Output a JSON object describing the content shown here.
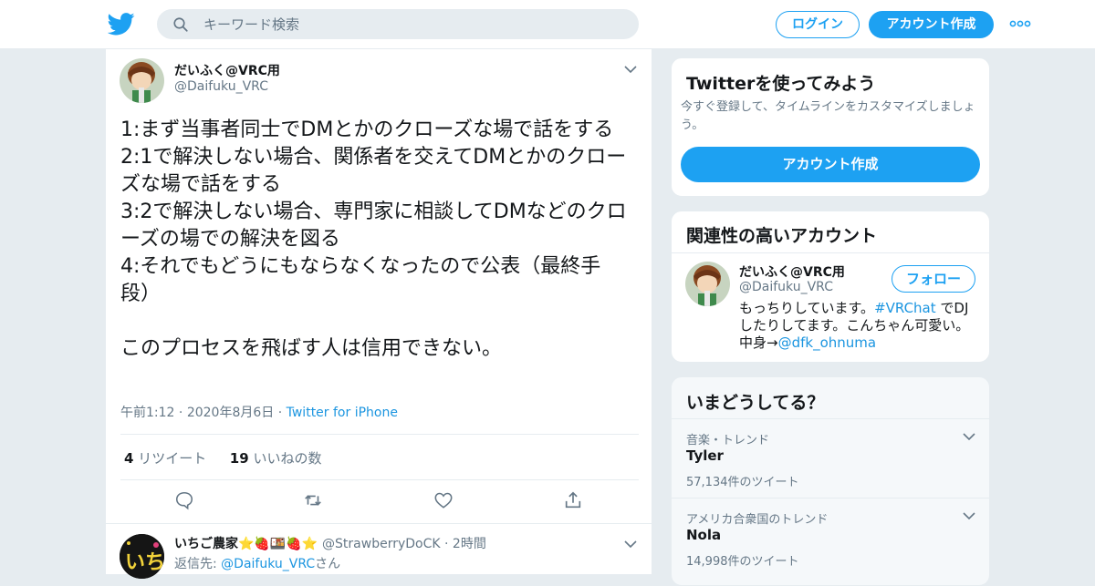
{
  "header": {
    "search_placeholder": "キーワード検索",
    "login_label": "ログイン",
    "signup_label": "アカウント作成",
    "brand_color": "#1da1f2"
  },
  "tweet": {
    "author_name": "だいふく@VRC用",
    "author_handle": "@Daifuku_VRC",
    "text": "1:まず当事者同士でDMとかのクローズな場で話をする\n2:1で解決しない場合、関係者を交えてDMとかのクローズな場で話をする\n3:2で解決しない場合、専門家に相談してDMなどのクローズの場での解決を図る\n4:それでもどうにもならなくなったので公表（最終手段）\n\nこのプロセスを飛ばす人は信用できない。",
    "time": "午前1:12",
    "date": "2020年8月6日",
    "source": "Twitter for iPhone",
    "retweets_count": "4",
    "retweets_label": "リツイート",
    "likes_count": "19",
    "likes_label": "いいねの数",
    "actions": [
      "reply-icon",
      "retweet-icon",
      "like-icon",
      "share-icon"
    ]
  },
  "reply": {
    "author_name": "いちご農家",
    "emoji": "⭐🍓🍱🍓⭐",
    "author_handle": "@StrawberryDoCK",
    "time": "2時間",
    "reply_to_prefix": "返信先: ",
    "reply_to_handle": "@Daifuku_VRC",
    "reply_to_suffix": "さん"
  },
  "signup_card": {
    "title": "Twitterを使ってみよう",
    "subtitle": "今すぐ登録して、タイムラインをカスタマイズしましょう。",
    "button_label": "アカウント作成"
  },
  "related_card": {
    "title": "関連性の高いアカウント",
    "account_name": "だいふく@VRC用",
    "account_handle": "@Daifuku_VRC",
    "follow_label": "フォロー",
    "bio_1": "もっちりしています。",
    "bio_hashtag": "#VRChat",
    "bio_2": " でDJしたりしてます。こんちゃん可愛い。　　中身→",
    "bio_mention": "@dfk_ohnuma"
  },
  "trends_card": {
    "title": "いまどうしてる？",
    "items": [
      {
        "context": "音楽・トレンド",
        "name": "Tyler",
        "count": "57,134件のツイート"
      },
      {
        "context": "アメリカ合衆国のトレンド",
        "name": "Nola",
        "count": "14,998件のツイート"
      }
    ]
  }
}
